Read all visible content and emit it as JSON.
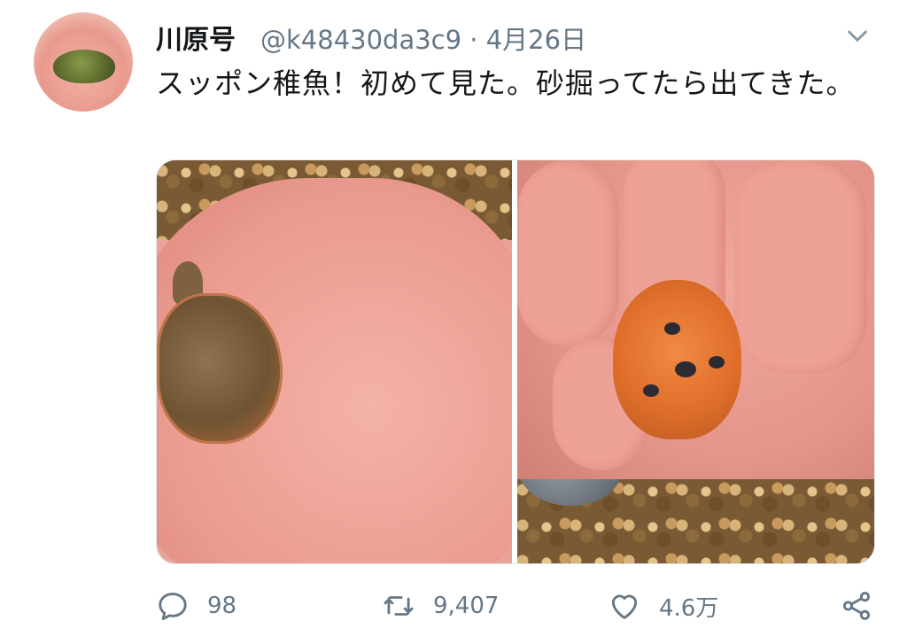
{
  "tweet": {
    "display_name": "川原号",
    "handle": "@k48430da3c9",
    "separator": "·",
    "date": "4月26日",
    "text": "スッポン稚魚！初めて見た。砂掘ってたら出てきた。",
    "media": [
      {
        "icon": "photo-turtle-back"
      },
      {
        "icon": "photo-turtle-belly"
      }
    ],
    "actions": {
      "replies": "98",
      "retweets": "9,407",
      "likes": "4.6万"
    }
  },
  "icons": {
    "more": "chevron-down-icon",
    "reply": "reply-icon",
    "retweet": "retweet-icon",
    "like": "heart-icon",
    "share": "share-icon"
  },
  "colors": {
    "text": "#14171a",
    "secondary": "#657786",
    "border": "#e1e8ed"
  }
}
